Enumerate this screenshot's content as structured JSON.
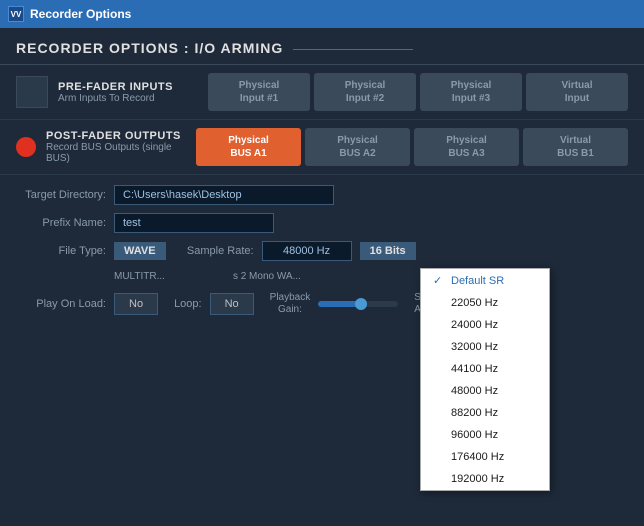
{
  "titleBar": {
    "icon": "VV",
    "title": "Recorder Options"
  },
  "sectionTitle": "RECORDER OPTIONS : I/O ARMING",
  "preFader": {
    "label": "PRE-FADER INPUTS",
    "sublabel": "Arm Inputs To Record",
    "buttons": [
      {
        "label": "Physical\nInput #1",
        "active": false
      },
      {
        "label": "Physical\nInput #2",
        "active": false
      },
      {
        "label": "Physical\nInput #3",
        "active": false
      },
      {
        "label": "Virtual\nInput",
        "active": false
      }
    ]
  },
  "postFader": {
    "label": "POST-FADER OUTPUTS",
    "sublabel": "Record BUS Outputs (single BUS)",
    "buttons": [
      {
        "label": "Physical\nBUS A1",
        "active": true
      },
      {
        "label": "Physical\nBUS A2",
        "active": false
      },
      {
        "label": "Physical\nBUS A3",
        "active": false
      },
      {
        "label": "Virtual\nBUS B1",
        "active": false
      }
    ]
  },
  "form": {
    "targetDirectoryLabel": "Target Directory:",
    "targetDirectoryValue": "C:\\Users\\hasek\\Desktop",
    "prefixNameLabel": "Prefix Name:",
    "prefixNameValue": "test",
    "fileTypeLabel": "File Type:",
    "fileTypeValue": "WAVE",
    "sampleRateLabel": "Sample Rate:",
    "sampleRateValue": "48000 Hz",
    "bitDepthValue": "16 Bits",
    "multitrackText": "MULTITR...",
    "multitrackExtra": "s 2 Mono WA...",
    "playOnLoadLabel": "Play On Load:",
    "playOnLoadValue": "No",
    "loopLabel": "Loop:",
    "loopValue": "No",
    "playbackGainLabel": "Playback\nGain:",
    "stopAfterLabel": "Stop /\nAfter D..."
  },
  "dropdown": {
    "items": [
      {
        "label": "Default SR",
        "selected": true
      },
      {
        "label": "22050 Hz",
        "selected": false
      },
      {
        "label": "24000 Hz",
        "selected": false
      },
      {
        "label": "32000 Hz",
        "selected": false
      },
      {
        "label": "44100 Hz",
        "selected": false
      },
      {
        "label": "48000 Hz",
        "selected": false
      },
      {
        "label": "88200 Hz",
        "selected": false
      },
      {
        "label": "96000 Hz",
        "selected": false
      },
      {
        "label": "176400 Hz",
        "selected": false
      },
      {
        "label": "192000 Hz",
        "selected": false
      }
    ]
  },
  "colors": {
    "accent": "#2a6db5",
    "active_btn": "#e06030",
    "inactive_btn": "#3a4a5a"
  }
}
